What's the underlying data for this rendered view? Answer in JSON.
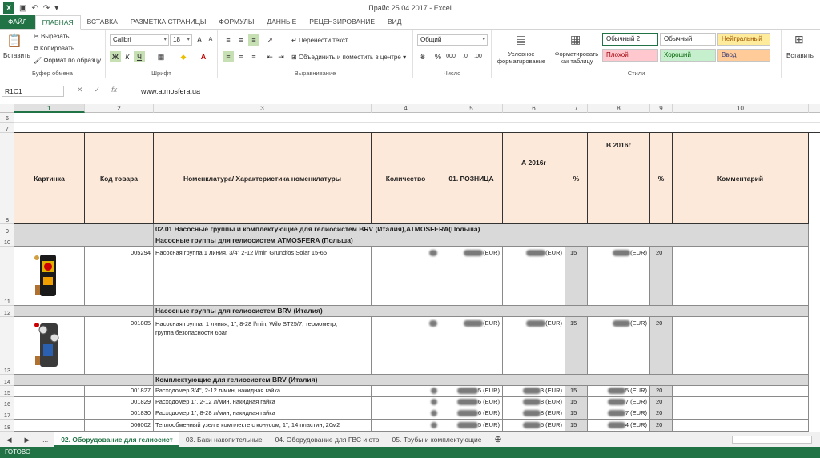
{
  "window": {
    "title": "Прайс 25.04.2017 - Excel"
  },
  "tabs": [
    "ФАЙЛ",
    "ГЛАВНАЯ",
    "ВСТАВКА",
    "РАЗМЕТКА СТРАНИЦЫ",
    "ФОРМУЛЫ",
    "ДАННЫЕ",
    "РЕЦЕНЗИРОВАНИЕ",
    "ВИД"
  ],
  "ribbon": {
    "clipboard": {
      "paste": "Вставить",
      "cut": "Вырезать",
      "copy": "Копировать",
      "format_painter": "Формат по образцу",
      "label": "Буфер обмена"
    },
    "font": {
      "name": "Calibri",
      "size": "18",
      "bold": "Ж",
      "italic": "К",
      "underline": "Ч",
      "label": "Шрифт"
    },
    "align": {
      "wrap": "Перенести текст",
      "merge": "Объединить и поместить в центре",
      "label": "Выравнивание"
    },
    "number": {
      "format": "Общий",
      "label": "Число"
    },
    "styles": {
      "cond": "Условное форматирование",
      "table": "Форматировать как таблицу",
      "label": "Стили",
      "normal2": "Обычный 2",
      "normal": "Обычный",
      "neutral": "Нейтральный",
      "bad": "Плохой",
      "good": "Хороший",
      "input": "Ввод"
    },
    "cells": {
      "insert": "Вставить"
    }
  },
  "formula_bar": {
    "name_box": "R1C1",
    "content": "www.atmosfera.ua"
  },
  "columns": [
    "1",
    "2",
    "3",
    "4",
    "5",
    "6",
    "7",
    "8",
    "9",
    "10"
  ],
  "rows": [
    "6",
    "7",
    "8",
    "9",
    "10",
    "11",
    "12",
    "13",
    "14",
    "15",
    "16",
    "17",
    "18"
  ],
  "headers": {
    "pic": "Картинка",
    "code": "Код товара",
    "name": "Номенклатура/ Характеристика номенклатуры",
    "qty": "Количество",
    "retail": "01. РОЗНИЦА",
    "a2016": "А 2016г",
    "pct1": "%",
    "b2016": "В 2016г",
    "pct2": "%",
    "comment": "Комментарий"
  },
  "sections": {
    "s1": "02.01 Насосные группы и комплектующие для гелиосистем BRV (Италия),ATMOSFERA(Польша)",
    "s2": "Насосные группы для гелиосистем ATMOSFERA (Польша)",
    "s3": "Насосные группы для гелиосистем BRV (Италия)",
    "s4": "Комплектующие для гелиосистем BRV (Италия)"
  },
  "items": [
    {
      "code": "005294",
      "name": "Насосная группа 1 линия, 3/4\" 2-12 l/min Grundfos Solar 15-65",
      "name2": "",
      "retail": "(EUR)",
      "a": "(EUR)",
      "p1": "15",
      "b": "(EUR)",
      "p2": "20"
    },
    {
      "code": "001805",
      "name": "Насосная группа, 1 линия, 1\", 8-28 l/min, Wilo ST25/7, термометр,",
      "name2": "группа безопасности 6bar",
      "retail": "(EUR)",
      "a": "(EUR)",
      "p1": "15",
      "b": "(EUR)",
      "p2": "20"
    },
    {
      "code": "001827",
      "name": "Расходомер  3/4\", 2-12 л/мин, накидная гайка",
      "name2": "",
      "retail": "5 (EUR)",
      "a": "3 (EUR)",
      "p1": "15",
      "b": "5 (EUR)",
      "p2": "20"
    },
    {
      "code": "001829",
      "name": "Расходомер 1\", 2-12 л/мин, накидная гайка",
      "name2": "",
      "retail": "6 (EUR)",
      "a": "8 (EUR)",
      "p1": "15",
      "b": "7 (EUR)",
      "p2": "20"
    },
    {
      "code": "001830",
      "name": "Расходомер 1\", 8-28 л/мин, накидная гайка",
      "name2": "",
      "retail": "6 (EUR)",
      "a": "8 (EUR)",
      "p1": "15",
      "b": "7 (EUR)",
      "p2": "20"
    },
    {
      "code": "006002",
      "name": "Теплообменный узел в комплекте с конусом, 1\", 14 пластин, 20м2",
      "name2": "",
      "retail": "5 (EUR)",
      "a": "5 (EUR)",
      "p1": "15",
      "b": "4 (EUR)",
      "p2": "20"
    }
  ],
  "sheets": [
    "02. Оборудование для гелиосист",
    "03. Баки накопительные",
    "04. Оборудование для ГВС и ото",
    "05. Трубы и комплектующие"
  ],
  "status": "ГОТОВО"
}
